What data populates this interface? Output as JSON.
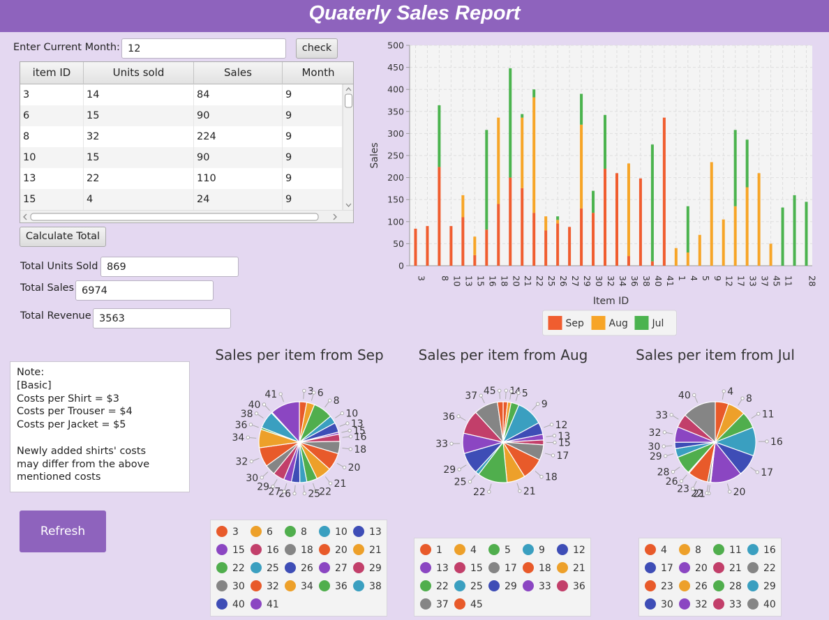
{
  "app": {
    "title": "Quaterly Sales Report"
  },
  "form": {
    "month_label": "Enter Current Month:",
    "month_value": "12",
    "check_label": "check"
  },
  "table": {
    "columns": [
      "item ID",
      "Units sold",
      "Sales",
      "Month"
    ],
    "rows": [
      [
        "3",
        "14",
        "84",
        "9"
      ],
      [
        "6",
        "15",
        "90",
        "9"
      ],
      [
        "8",
        "32",
        "224",
        "9"
      ],
      [
        "10",
        "15",
        "90",
        "9"
      ],
      [
        "13",
        "22",
        "110",
        "9"
      ],
      [
        "15",
        "4",
        "24",
        "9"
      ]
    ]
  },
  "totals": {
    "calculate_label": "Calculate Total",
    "units_label": "Total Units Sold",
    "units_value": "869",
    "sales_label": "Total Sales",
    "sales_value": "6974",
    "revenue_label": "Total Revenue",
    "revenue_value": "3563"
  },
  "note": {
    "lines": [
      "Note:",
      "[Basic]",
      "Costs per Shirt = $3",
      "Costs per Trouser = $4",
      "Costs per Jacket = $5",
      "",
      "Newly added shirts' costs",
      "may differ from the above",
      "mentioned costs"
    ]
  },
  "refresh_label": "Refresh",
  "colors": {
    "sep": "#f05d2f",
    "aug": "#f7a527",
    "jul": "#4bb34e",
    "accent": "#8e63bd"
  },
  "chart_data": [
    {
      "type": "bar",
      "stacked": true,
      "title": "",
      "xlabel": "Item ID",
      "ylabel": "Sales",
      "ylim": [
        0,
        500
      ],
      "yticks": [
        0,
        50,
        100,
        150,
        200,
        250,
        300,
        350,
        400,
        450,
        500
      ],
      "grid": true,
      "legend_position": "bottom",
      "categories": [
        "3",
        "6",
        "8",
        "10",
        "13",
        "15",
        "16",
        "18",
        "20",
        "21",
        "22",
        "25",
        "26",
        "27",
        "29",
        "30",
        "32",
        "34",
        "36",
        "38",
        "40",
        "41",
        "1",
        "4",
        "5",
        "9",
        "12",
        "17",
        "33",
        "37",
        "45",
        "11",
        "23",
        "28"
      ],
      "visible_tick_labels": [
        "3",
        "8",
        "10",
        "13",
        "15",
        "16",
        "18",
        "20",
        "21",
        "22",
        "25",
        "26",
        "27",
        "29",
        "30",
        "32",
        "34",
        "36",
        "38",
        "40",
        "41",
        "1",
        "4",
        "5",
        "9",
        "12",
        "17",
        "33",
        "37",
        "45",
        "11",
        "28"
      ],
      "series": [
        {
          "name": "Sep",
          "color": "#f05d2f",
          "values": [
            84,
            90,
            224,
            90,
            110,
            24,
            82,
            140,
            200,
            176,
            120,
            80,
            96,
            88,
            130,
            120,
            220,
            210,
            22,
            198,
            10,
            336,
            0,
            0,
            0,
            0,
            0,
            0,
            0,
            0,
            0,
            0,
            0,
            0
          ]
        },
        {
          "name": "Aug",
          "color": "#f7a527",
          "values": [
            0,
            0,
            0,
            0,
            50,
            42,
            0,
            196,
            0,
            160,
            262,
            32,
            8,
            0,
            190,
            0,
            0,
            0,
            210,
            0,
            0,
            0,
            40,
            30,
            70,
            235,
            105,
            135,
            178,
            210,
            50,
            0,
            0,
            0
          ]
        },
        {
          "name": "Jul",
          "color": "#4bb34e",
          "values": [
            0,
            0,
            140,
            0,
            0,
            0,
            226,
            0,
            248,
            8,
            18,
            0,
            8,
            0,
            70,
            50,
            122,
            0,
            0,
            0,
            265,
            0,
            0,
            105,
            0,
            0,
            0,
            173,
            108,
            0,
            0,
            132,
            160,
            145
          ]
        }
      ]
    },
    {
      "type": "pie",
      "title": "Sales per item from Sep",
      "labels": [
        "3",
        "6",
        "8",
        "10",
        "13",
        "15",
        "16",
        "18",
        "20",
        "21",
        "22",
        "25",
        "26",
        "27",
        "29",
        "30",
        "32",
        "34",
        "36",
        "38",
        "40",
        "41"
      ],
      "values": [
        84,
        90,
        224,
        90,
        110,
        24,
        82,
        140,
        200,
        176,
        120,
        80,
        96,
        88,
        130,
        120,
        220,
        210,
        22,
        198,
        10,
        336
      ]
    },
    {
      "type": "pie",
      "title": "Sales per item from Aug",
      "labels": [
        "1",
        "4",
        "5",
        "9",
        "12",
        "13",
        "15",
        "17",
        "18",
        "21",
        "22",
        "25",
        "29",
        "33",
        "36",
        "37",
        "45"
      ],
      "values": [
        40,
        30,
        70,
        235,
        105,
        50,
        42,
        135,
        196,
        160,
        262,
        32,
        190,
        178,
        210,
        210,
        50
      ]
    },
    {
      "type": "pie",
      "title": "Sales per item from Jul",
      "labels": [
        "4",
        "8",
        "11",
        "16",
        "17",
        "20",
        "21",
        "22",
        "23",
        "26",
        "28",
        "29",
        "30",
        "32",
        "33",
        "40"
      ],
      "values": [
        105,
        140,
        132,
        226,
        173,
        248,
        8,
        18,
        160,
        8,
        145,
        70,
        50,
        122,
        108,
        265
      ]
    }
  ],
  "pie_palette": [
    "#e85a2a",
    "#eda02a",
    "#50ae4d",
    "#3a9fc0",
    "#3e4db6",
    "#8b46c2",
    "#c23f6a",
    "#858585"
  ]
}
